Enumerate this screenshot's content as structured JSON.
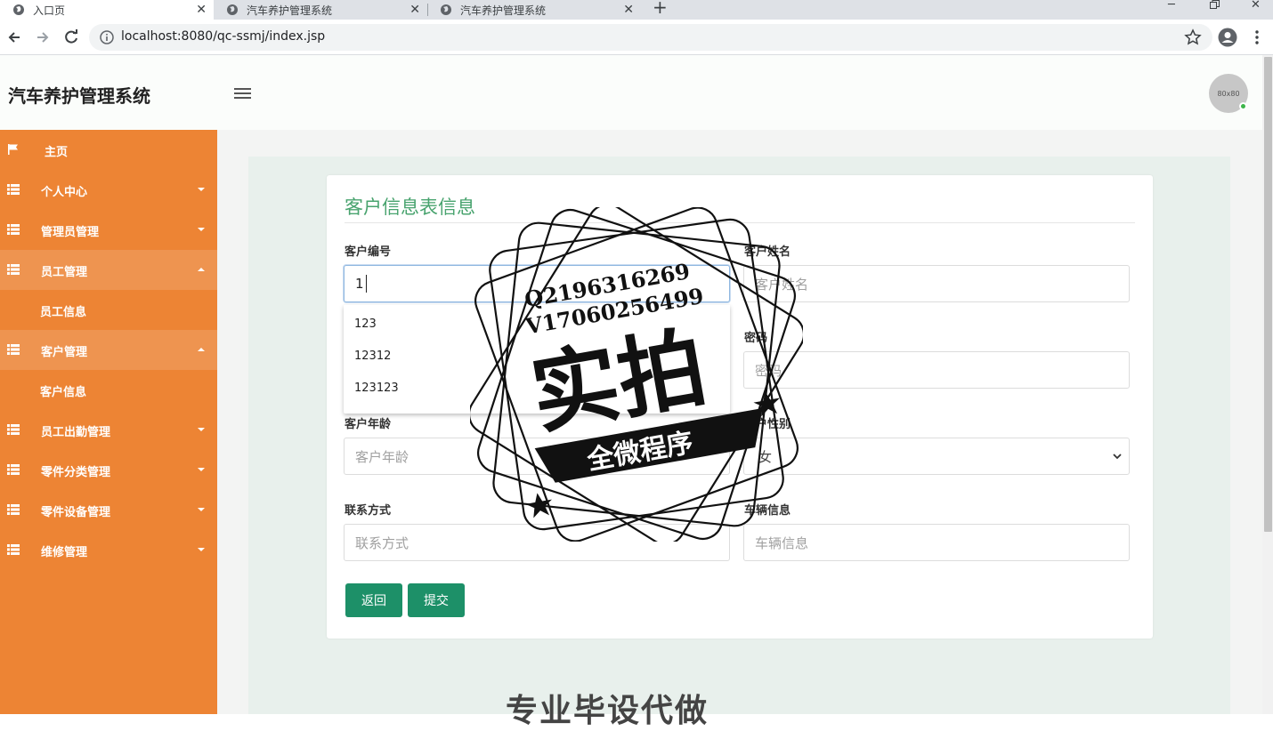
{
  "browser": {
    "tabs": [
      {
        "title": "入口页",
        "active": true
      },
      {
        "title": "汽车养护管理系统",
        "active": false
      },
      {
        "title": "汽车养护管理系统",
        "active": false
      }
    ],
    "url": "localhost:8080/qc-ssmj/index.jsp"
  },
  "header": {
    "brand": "汽车养护管理系统",
    "avatar_text": "80x80"
  },
  "sidebar": {
    "items": [
      {
        "label": "主页",
        "icon": "flag-icon"
      },
      {
        "label": "个人中心",
        "icon": "grid-icon"
      },
      {
        "label": "管理员管理",
        "icon": "grid-icon"
      },
      {
        "label": "员工管理",
        "icon": "grid-icon"
      },
      {
        "label": "员工信息",
        "icon": ""
      },
      {
        "label": "客户管理",
        "icon": "grid-icon"
      },
      {
        "label": "客户信息",
        "icon": ""
      },
      {
        "label": "员工出勤管理",
        "icon": "grid-icon"
      },
      {
        "label": "零件分类管理",
        "icon": "grid-icon"
      },
      {
        "label": "零件设备管理",
        "icon": "grid-icon"
      },
      {
        "label": "维修管理",
        "icon": "grid-icon"
      }
    ]
  },
  "form": {
    "title": "客户信息表信息",
    "customer_id": {
      "label": "客户编号",
      "value": "1"
    },
    "customer_name": {
      "label": "客户姓名",
      "placeholder": "客户姓名"
    },
    "password": {
      "label": "密码",
      "placeholder": "密码"
    },
    "customer_age": {
      "label": "客户年龄",
      "placeholder": "客户年龄"
    },
    "customer_gender": {
      "label": "客户性别",
      "value": "女"
    },
    "contact": {
      "label": "联系方式",
      "placeholder": "联系方式"
    },
    "vehicle": {
      "label": "车辆信息",
      "placeholder": "车辆信息"
    },
    "autocomplete": [
      "123",
      "12312",
      "123123"
    ],
    "back_label": "返回",
    "submit_label": "提交"
  },
  "watermark": {
    "line1": "Q2196316269",
    "line2": "V17060256499",
    "big": "实拍",
    "banner": "全微程序"
  },
  "footer_banner": "专业毕设代做"
}
